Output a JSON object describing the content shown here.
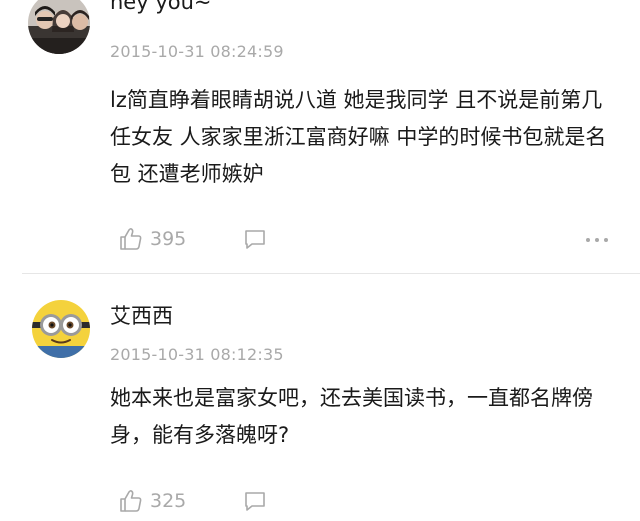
{
  "comments": [
    {
      "username": "hey you~",
      "timestamp": "2015-10-31 08:24:59",
      "content": "lz简直睁着眼睛胡说八道 她是我同学 且不说是前第几任女友 人家家里浙江富商好嘛 中学的时候书包就是名包 还遭老师嫉妒",
      "likes": "395",
      "avatar_icon": "group-photo-avatar"
    },
    {
      "username": "艾西西",
      "timestamp": "2015-10-31 08:12:35",
      "content": "她本来也是富家女吧，还去美国读书，一直都名牌傍身，能有多落魄呀?",
      "likes": "325",
      "avatar_icon": "minion-avatar"
    }
  ],
  "icons": {
    "like": "thumbs-up-icon",
    "reply": "comment-bubble-icon",
    "more": "more-dots-icon"
  },
  "colors": {
    "text": "#1a1a1a",
    "meta": "#a9a9a9",
    "divider": "#e6e6e6"
  }
}
